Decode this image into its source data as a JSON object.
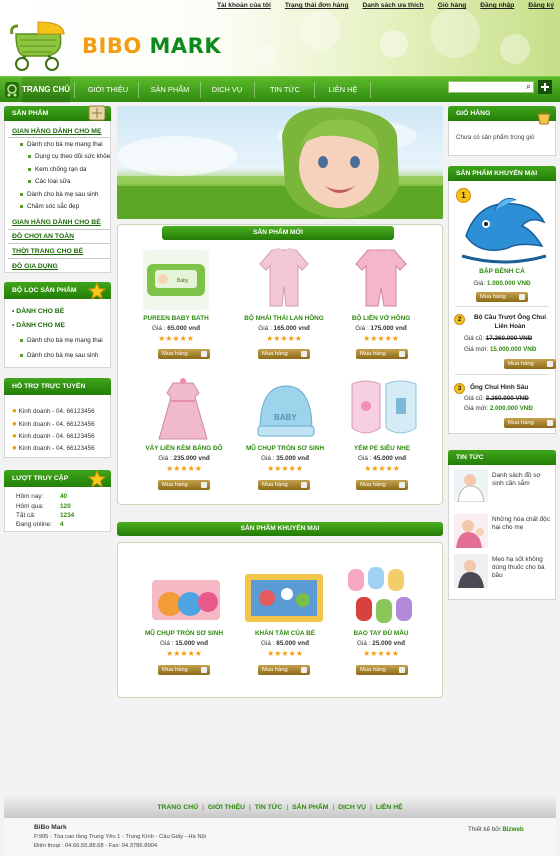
{
  "top_links": [
    "Tài khoản của tôi",
    "Trạng thái đơn hàng",
    "Danh sách ưa thích",
    "Giỏ hàng",
    "Đăng nhập",
    "Đăng ký"
  ],
  "logo": {
    "part1": "BIBO",
    "part2": "MARK"
  },
  "nav": {
    "home": "TRANG CHỦ",
    "items": [
      "GIỚI THIỆU",
      "SẢN PHẨM",
      "DỊCH VỤ",
      "TIN TỨC",
      "LIÊN HỆ"
    ]
  },
  "sidebar_left": {
    "products_title": "SẢN PHẨM",
    "menu": [
      {
        "label": "GIAN HÀNG DÀNH CHO MẸ",
        "level": 0
      },
      {
        "label": "Dành cho bà mẹ mang thai",
        "level": 1
      },
      {
        "label": "Dụng cụ theo dõi sức khỏe",
        "level": 2
      },
      {
        "label": "Kem chống rạn da",
        "level": 2
      },
      {
        "label": "Các loại sữa",
        "level": 2
      },
      {
        "label": "Dành cho bà mẹ sau sinh",
        "level": 1
      },
      {
        "label": "Chăm sóc sắc đẹp",
        "level": 1
      },
      {
        "label": "GIAN HÀNG DÀNH CHO BÉ",
        "level": 0
      },
      {
        "label": "ĐỒ CHƠI AN TOÀN",
        "level": 0
      },
      {
        "label": "THỜI TRANG CHO BÉ",
        "level": 0
      },
      {
        "label": "ĐỒ GIA DỤNG",
        "level": 0
      }
    ],
    "filter_title": "BỘ LỌC SẢN PHẨM",
    "filter": [
      {
        "label": "DÀNH CHO BÉ",
        "level": 0
      },
      {
        "label": "DÀNH CHO MẸ",
        "level": 0
      },
      {
        "label": "Dành cho bà mẹ mang thai",
        "level": 1
      },
      {
        "label": "Dành cho bà mẹ sau sinh",
        "level": 1
      }
    ],
    "support_title": "HỖ TRỢ TRỰC TUYẾN",
    "support": [
      "Kinh doanh - 04. 66123456",
      "Kinh doanh - 04. 66123456",
      "Kinh doanh - 04. 66123456",
      "Kinh doanh - 04. 66123456"
    ],
    "visits_title": "LƯỢT TRUY CẬP",
    "visits": [
      {
        "label": "Hôm nay:",
        "value": "40"
      },
      {
        "label": "Hôm qua:",
        "value": "120"
      },
      {
        "label": "Tất cả:",
        "value": "1234"
      },
      {
        "label": "Đang online:",
        "value": "4"
      }
    ]
  },
  "new_products": {
    "title": "SẢN PHẨM MỚI",
    "items": [
      {
        "name": "PUREEN BABY BATH",
        "price_label": "Giá :",
        "price": "65.000 vnđ",
        "buy": "Mua hàng"
      },
      {
        "name": "BỘ NHÁI THÁI LAN HỒNG",
        "price_label": "Giá :",
        "price": "165.000 vnđ",
        "buy": "Mua hàng"
      },
      {
        "name": "BỘ LIỀN VỚ HỒNG",
        "price_label": "Giá :",
        "price": "175.000 vnđ",
        "buy": "Mua hàng"
      },
      {
        "name": "VÁY LIỀN KÈM BĂNG ĐÔ",
        "price_label": "Giá :",
        "price": "235.000 vnđ",
        "buy": "Mua hàng"
      },
      {
        "name": "MŨ CHỤP TRÒN SƠ SINH",
        "price_label": "Giá :",
        "price": "35.000 vnđ",
        "buy": "Mua hàng"
      },
      {
        "name": "YẾM PE SIÊU NHẸ",
        "price_label": "Giá :",
        "price": "45.000 vnđ",
        "buy": "Mua hàng"
      }
    ]
  },
  "promo_products": {
    "title": "SẢN PHẨM KHUYẾN MẠI",
    "items": [
      {
        "name": "MŨ CHỤP TRÒN SƠ SINH",
        "price_label": "Giá :",
        "price": "15.000 vnđ",
        "buy": "Mua hàng"
      },
      {
        "name": "KHĂN TẮM CỦA BÉ",
        "price_label": "Giá :",
        "price": "85.000 vnđ",
        "buy": "Mua hàng"
      },
      {
        "name": "BAO TAY ĐỦ MẦU",
        "price_label": "Giá :",
        "price": "25.000 vnđ",
        "buy": "Mua hàng"
      }
    ]
  },
  "cart": {
    "title": "GIỎ HÀNG",
    "empty": "Chưa có sản phẩm trong giỏ"
  },
  "promo_side": {
    "title": "SẢN PHẨM KHUYẾN MẠI",
    "first": {
      "rank": "1",
      "name": "BẬP BÊNH CÁ",
      "price_label": "Giá:",
      "price": "1.000.000 VNĐ",
      "buy": "Mua hàng"
    },
    "items": [
      {
        "rank": "2",
        "name": "Bộ Cầu Trượt Ống Chui Liên Hoàn",
        "old_label": "Giá cũ:",
        "old": "17.260.000 VNĐ",
        "new_label": "Giá mới:",
        "new": "15.000.000 VNĐ",
        "buy": "Mua hàng"
      },
      {
        "rank": "3",
        "name": "Ống Chui Hình Sâu",
        "old_label": "Giá cũ:",
        "old": "3.260.000 VNĐ",
        "new_label": "Giá mới:",
        "new": "2.000.000 VNĐ",
        "buy": "Mua hàng"
      }
    ]
  },
  "news": {
    "title": "TIN TỨC",
    "items": [
      "Danh sách đồ sơ sinh cần sắm",
      "Những hóa chất độc hại cho mẹ",
      "Mẹo hạ sốt không dùng thuốc cho bà bầu"
    ]
  },
  "footer_nav": [
    "TRANG CHỦ",
    "GIỚI THIỆU",
    "TIN TỨC",
    "SẢN PHẨM",
    "DỊCH VỤ",
    "LIÊN HỆ"
  ],
  "footer": {
    "company": "BiBo Mark",
    "address": "P.905 - Tòa cao tầng Trung Yên 1 - Trung Kính - Cầu Giấy - Hà Nội",
    "phone": "Điện thoại : 04.66.55.88.68 - Fax: 04.3786.8904",
    "designed": "Thiết kế bởi",
    "designer": "Bizweb"
  },
  "colors": {
    "brand_green": "#2f8a10",
    "accent_orange": "#f29d10",
    "price_red": "#c00000"
  }
}
